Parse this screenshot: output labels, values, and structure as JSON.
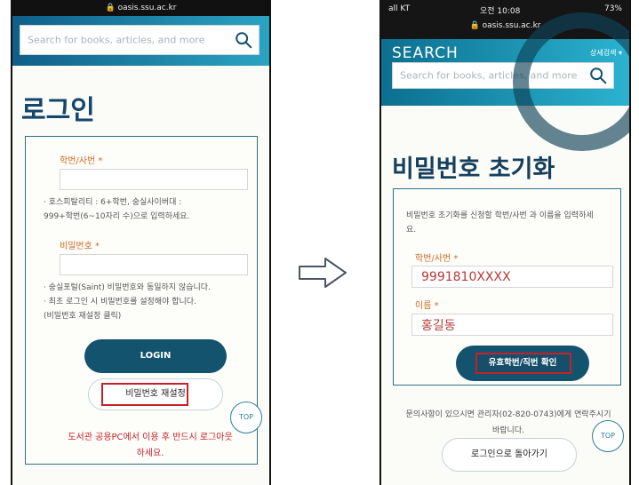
{
  "left": {
    "status_url": "oasis.ssu.ac.kr",
    "search_placeholder": "Search for books, articles, and more",
    "login_title": "로그인",
    "id_label": "학번/사번 *",
    "id_help_1": "· 호스피탈리티 : 6+학번, 숭실사이버대 :",
    "id_help_2": "999+학번(6~10자리 수)으로 입력하세요.",
    "password_label": "비밀번호 *",
    "password_help_1": "· 숭실포털(Saint) 비밀번호와 동일하지 않습니다.",
    "password_help_2": "· 최초 로그인 시 비밀번호를 설정해야 합니다.",
    "password_help_3": "(비밀번호 재설정 클릭)",
    "login_button": "LOGIN",
    "reset_password_button": "비밀번호 재설정",
    "top_button": "TOP",
    "warning_1": "도서관 공용PC에서 이용 후 반드시 로그아웃",
    "warning_2": "하세요."
  },
  "right": {
    "status_carrier": "all KT",
    "status_time": "오전 10:08",
    "status_battery": "73%",
    "status_url": "oasis.ssu.ac.kr",
    "search_heading": "SEARCH",
    "detail_search": "상세검색 ▾",
    "search_placeholder": "Search for books, articles, and more",
    "reset_title": "비밀번호 초기화",
    "reset_desc": "비밀번호 초기화를 신청할 학번/사번 과 이름을 입력하세요.",
    "id_label": "학번/사번 *",
    "id_value": "9991810XXXX",
    "name_label": "이름 *",
    "name_value": "홍길동",
    "confirm_button": "유효학번/직번 확인",
    "footer_note_1": "문의사항이 있으시면 관리자(02-820-0743)에게 연락주시기",
    "footer_note_2": "바랍니다.",
    "top_button": "TOP",
    "back_to_login_button": "로그인으로 돌아가기"
  },
  "colors": {
    "brand_dark": "#14536e",
    "highlight_red": "#c62129",
    "label_orange": "#d06a24"
  }
}
